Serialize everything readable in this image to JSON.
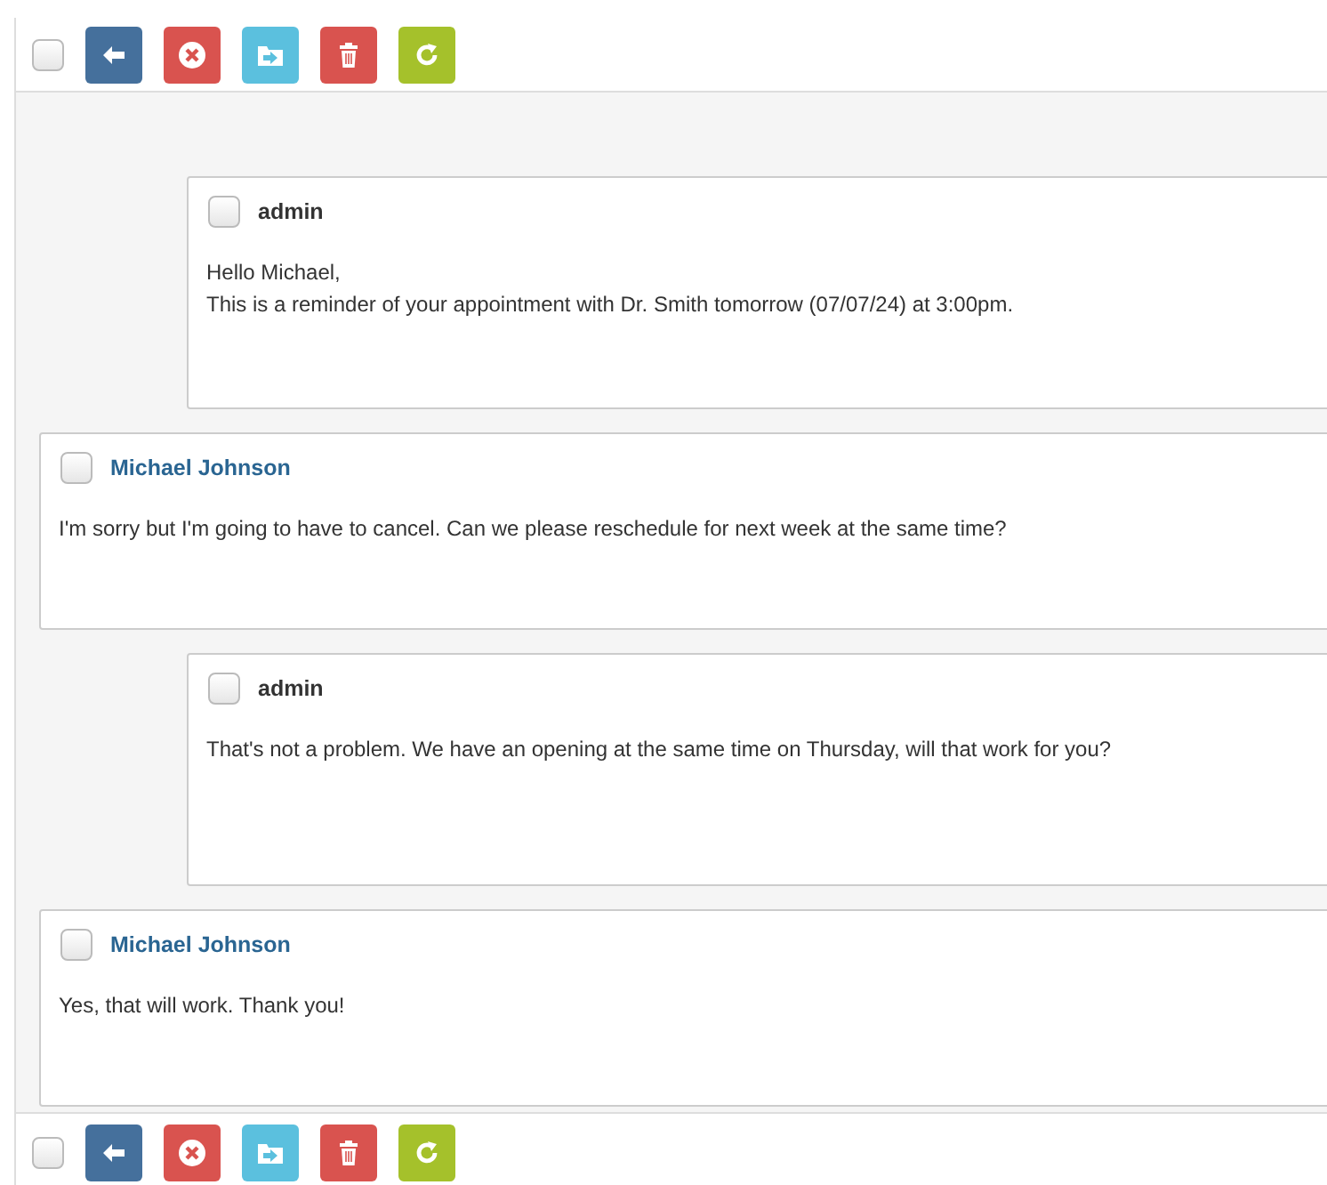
{
  "top_toolbar": {
    "checked": false,
    "buttons": [
      {
        "kind": "back"
      },
      {
        "kind": "close"
      },
      {
        "kind": "move"
      },
      {
        "kind": "delete"
      },
      {
        "kind": "refresh"
      }
    ]
  },
  "messages": [
    {
      "kind": "staff",
      "sender": "admin",
      "checked": false,
      "lines": [
        "Hello Michael,",
        "This is a reminder of your appointment with Dr. Smith tomorrow (07/07/24) at 3:00pm."
      ]
    },
    {
      "kind": "client",
      "sender": "Michael Johnson",
      "checked": false,
      "lines": [
        "I'm sorry but I'm going to have to cancel. Can we please reschedule for next week at the same time?"
      ]
    },
    {
      "kind": "staff",
      "sender": "admin",
      "checked": false,
      "lines": [
        "That's not a problem. We have an opening at the same time on Thursday, will that work for you?"
      ]
    },
    {
      "kind": "client",
      "sender": "Michael Johnson",
      "checked": false,
      "lines": [
        "Yes, that will work. Thank you!"
      ]
    }
  ],
  "bottom_toolbar": {
    "checked": false,
    "buttons": [
      {
        "kind": "back"
      },
      {
        "kind": "close"
      },
      {
        "kind": "move"
      },
      {
        "kind": "delete"
      },
      {
        "kind": "refresh"
      }
    ]
  }
}
